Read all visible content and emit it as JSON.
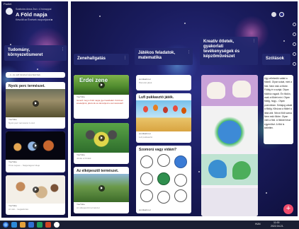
{
  "app": {
    "label": "Padlet"
  },
  "padlet": {
    "owner": "Szabolcs Anna Zsó • 4 hónappal",
    "title": "A Föld napja",
    "subtitle": "Készült az Érzések csoportjával"
  },
  "columns": [
    {
      "title": "Tudomány, környezetismeret"
    },
    {
      "title": "Zenehallgatás"
    },
    {
      "title": "Játékos feladatok, matematika"
    },
    {
      "title": "Kreatív ötletek, gyakorlati tevékenységek és képzőművészet"
    },
    {
      "title": "Szólások"
    }
  ],
  "column_menu_icon": "more-dots-icon",
  "left_cards": {
    "strip": "- 3 - KL.W8 MOZGÓ ÉGITESTEK",
    "c1_title": "Nyolc perc természet.",
    "c1_src": "YouTube",
    "c1_note": "Nyolc perc természet 1.rész",
    "c2_src": "YouTube",
    "c2_note": "Vírus Lajoss – Napja Egész Ideje",
    "c3_src": "YouTube",
    "c3_note": "Az élet - megtekintés"
  },
  "music_cards": {
    "top_banner": "Erdei zene",
    "top_src": "YouTube",
    "top_note": "Ismerd meg a Föld napja gyermekdalait. Közösen énekeljünk, játszunk és táncoljunk a természetért!",
    "mid_src": "YouTube",
    "mid_note": "Jónás a Cinkék",
    "c3_title": "Az elképesztő természet.",
    "c3_src": "YouTube",
    "c3_note": "Az elképesztő természet"
  },
  "game_cards": {
    "top_src": "wordwall.net",
    "top_note": "Párosító játék",
    "c2_title": "Lufi pukkasztó játék.",
    "c2_src": "wordwall.net",
    "c2_note": "Lufi pukkasztó",
    "c3_title": "Szomorú vagy vidám?",
    "c3_src": "wordwall.net"
  },
  "side_text": "Úgy vélekedik valaki a földről. Olyan sokat, mint a föld. Nem esik a földre. Földig ér a szájá. Olyan földhöz ragadt. Én földön, csak a földet nézi. Olyan földig, hogy... Olyan pozícióban. Sóhajog valaki a földig. Kihúzza a földet a lába alól. Nincs földi szava. Nem esik földre. Olyan mint a föld. A földdel teszi egyenlővé. A föld is kelletlen.",
  "taskbar": {
    "lang": "HUN",
    "time": "11:00",
    "date": "2022.04.21."
  },
  "colors": {
    "background_top": "#2b2f86",
    "background_bottom": "#0d0e38",
    "fab": "#ef4b6c",
    "taskbar": "#1a1f33"
  }
}
